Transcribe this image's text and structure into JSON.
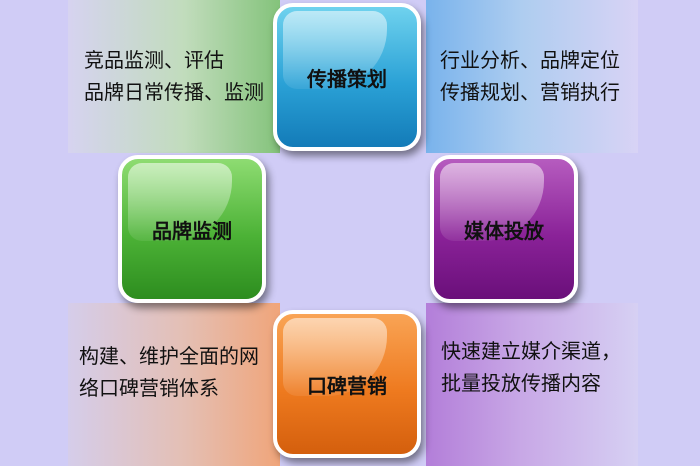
{
  "center_items": {
    "top": "传播策划",
    "left": "品牌监测",
    "right": "媒体投放",
    "bottom": "口碑营销"
  },
  "descriptions": {
    "top_left": [
      "竞品监测、评估",
      "品牌日常传播、监测"
    ],
    "top_right": [
      "行业分析、品牌定位",
      "传播规划、营销执行"
    ],
    "bottom_left": [
      "构建、维护全面的网",
      "络口碑营销体系"
    ],
    "bottom_right": [
      "快速建立媒介渠道，",
      "批量投放传播内容"
    ]
  },
  "colors": {
    "background": "#d0ccf6",
    "top_tile": "#2aa1d6",
    "left_tile": "#4cb236",
    "right_tile": "#8a2298",
    "bottom_tile": "#ee7a1f",
    "tile_border": "#ffffff"
  }
}
